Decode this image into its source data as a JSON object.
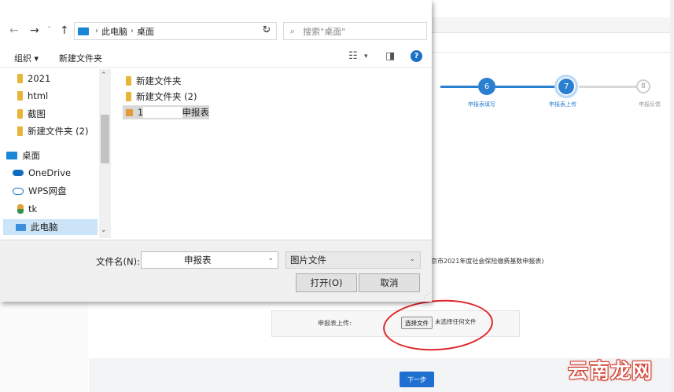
{
  "background_page": {
    "steps": [
      {
        "number": "6",
        "label": "申报表填写",
        "state": "done"
      },
      {
        "number": "7",
        "label": "申报表上传",
        "state": "active"
      },
      {
        "number": "8",
        "label": "申报反馈",
        "state": "pending"
      }
    ],
    "form_title": "京市2021年度社会保险缴费基数申报表)",
    "upload_label": "申报表上传:",
    "choose_file_button": "选择文件",
    "no_file_text": "未选择任何文件",
    "next_button": "下一步",
    "accent_color": "#1f6fd1",
    "highlight_color": "#e0262a"
  },
  "dialog": {
    "nav": {
      "back": "←",
      "forward": "→",
      "recent": "˅",
      "up": "↑",
      "refresh": "↻"
    },
    "breadcrumb": [
      "此电脑",
      "桌面"
    ],
    "search_placeholder": "搜索\"桌面\"",
    "toolbar": {
      "organize": "组织 ▾",
      "new_folder": "新建文件夹",
      "help": "?"
    },
    "sidebar": {
      "items": [
        {
          "label": "2021",
          "icon": "folder-icon"
        },
        {
          "label": "html",
          "icon": "folder-icon"
        },
        {
          "label": "截图",
          "icon": "folder-icon"
        },
        {
          "label": "新建文件夹 (2)",
          "icon": "folder-icon"
        },
        {
          "label": "桌面",
          "icon": "desktop-icon"
        },
        {
          "label": "OneDrive",
          "icon": "cloud-icon"
        },
        {
          "label": "WPS网盘",
          "icon": "wps-cloud-icon"
        },
        {
          "label": "tk",
          "icon": "user-icon"
        },
        {
          "label": "此电脑",
          "icon": "computer-icon"
        }
      ]
    },
    "files": [
      {
        "name": "新建文件夹",
        "icon": "folder-icon"
      },
      {
        "name": "新建文件夹 (2)",
        "icon": "folder-icon"
      },
      {
        "name_prefix": "1",
        "name_suffix": "申报表",
        "icon": "image-file-icon"
      }
    ],
    "filename_label": "文件名(N):",
    "filename_value": "申报表",
    "filetype_value": "图片文件",
    "open_button": "打开(O)",
    "cancel_button": "取消"
  },
  "watermark": "云南龙网"
}
